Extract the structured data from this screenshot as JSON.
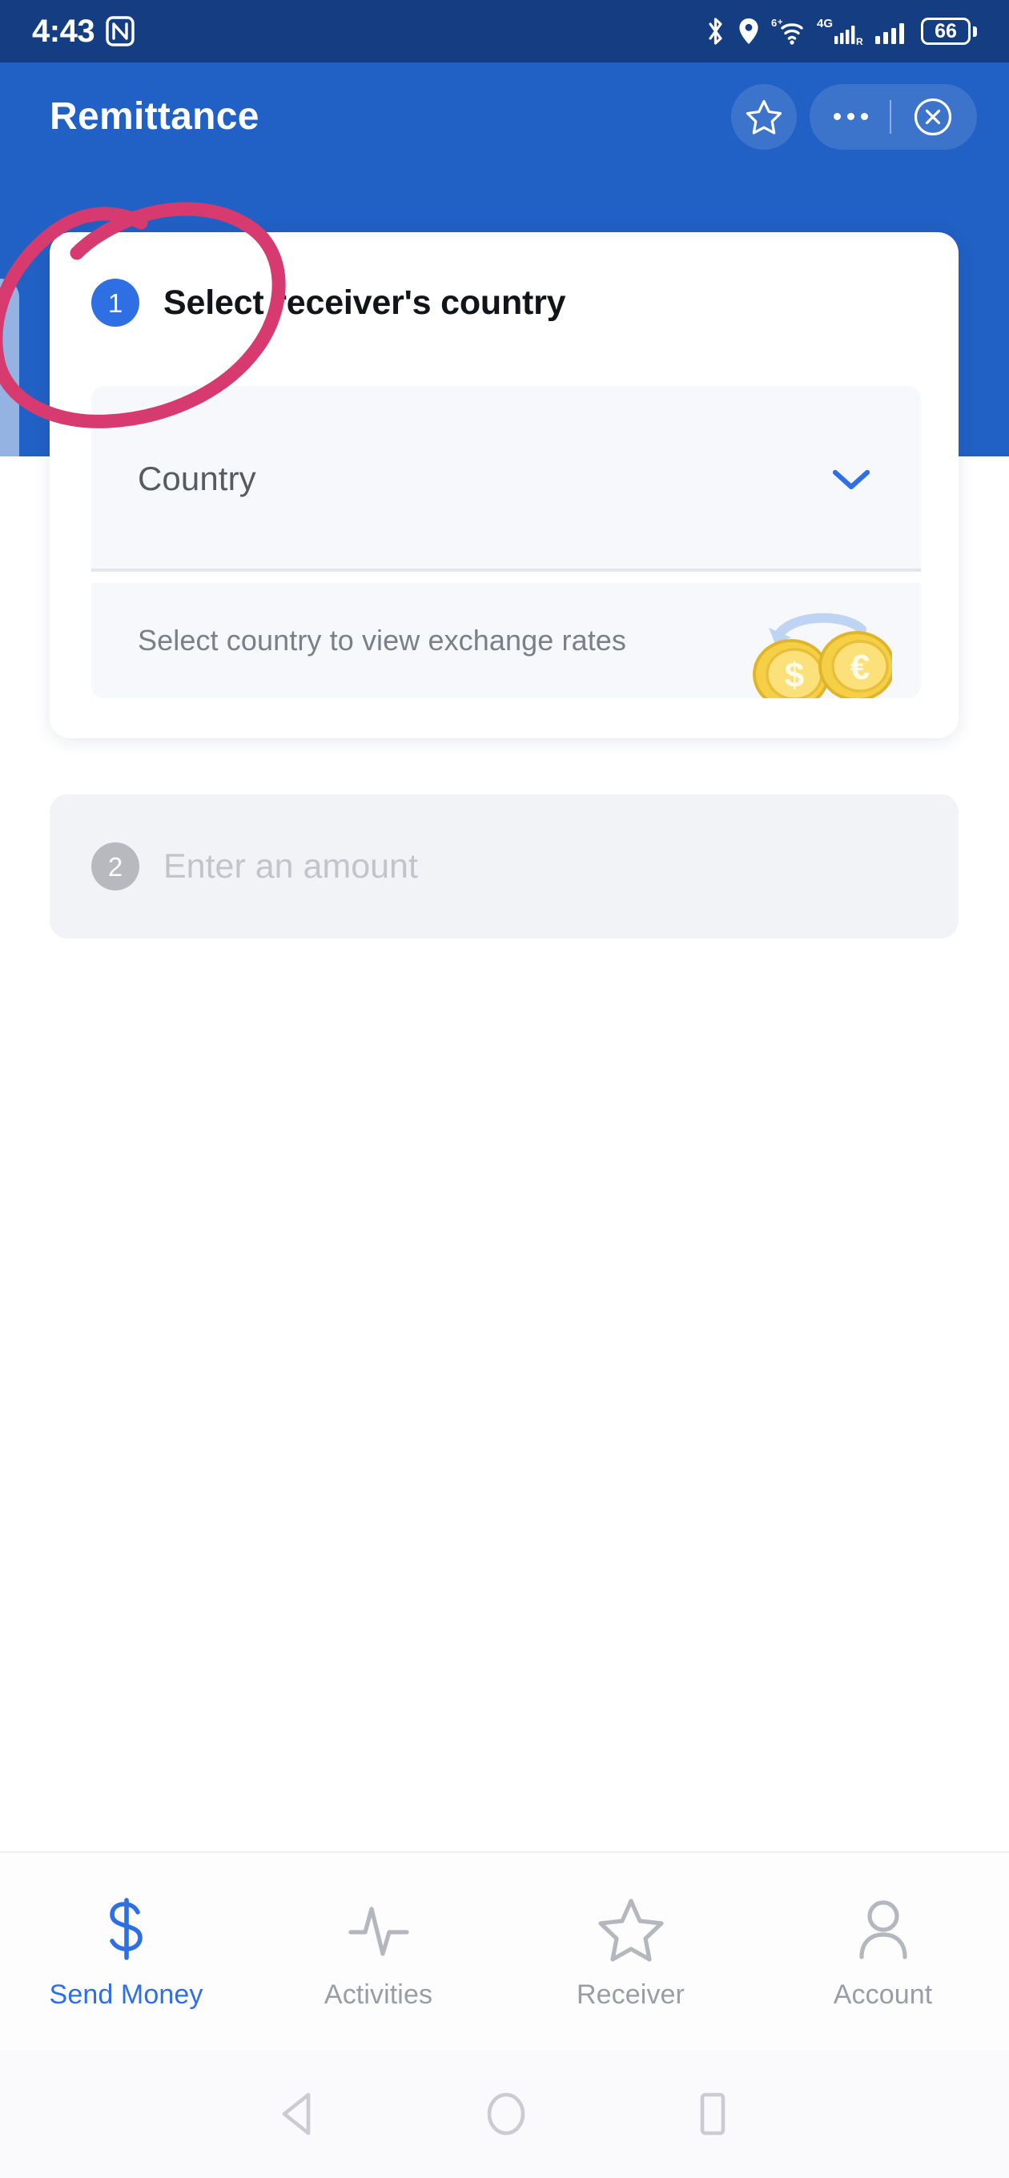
{
  "status_bar": {
    "time": "4:43",
    "icons": [
      "nfc-icon",
      "bluetooth-icon",
      "location-icon",
      "wifi-icon",
      "signal-4g-icon",
      "signal-bars-icon"
    ],
    "battery_level": "66"
  },
  "header": {
    "title": "Remittance",
    "favorite_icon": "star-outline-icon",
    "more_icon": "more-horizontal-icon",
    "close_icon": "close-circle-icon",
    "background_color": "#2160C4"
  },
  "step_one": {
    "number": "1",
    "title": "Select receiver's country",
    "country_select": {
      "placeholder": "Country",
      "value": "",
      "chevron_icon": "chevron-down-icon"
    },
    "rate_hint": "Select country to view exchange rates",
    "coin_symbols": [
      "$",
      "€"
    ]
  },
  "step_two": {
    "number": "2",
    "title": "Enter an amount",
    "disabled": true
  },
  "bottom_nav": {
    "items": [
      {
        "label": "Send Money",
        "icon": "dollar-sign-icon",
        "active": true
      },
      {
        "label": "Activities",
        "icon": "activity-pulse-icon",
        "active": false
      },
      {
        "label": "Receiver",
        "icon": "star-outline-icon",
        "active": false
      },
      {
        "label": "Account",
        "icon": "person-icon",
        "active": false
      }
    ]
  },
  "system_nav": {
    "back_icon": "triangle-back-icon",
    "home_icon": "circle-home-icon",
    "recents_icon": "square-recents-icon"
  },
  "annotation": {
    "type": "hand-drawn-circle",
    "color": "#D63A6E",
    "target": "country-select-field"
  },
  "colors": {
    "status_bar": "#153E82",
    "header": "#2160C4",
    "accent": "#2F6FE4",
    "annotation": "#D63A6E",
    "field_bg": "#F6F8FB",
    "disabled": "#C2C4C9"
  }
}
